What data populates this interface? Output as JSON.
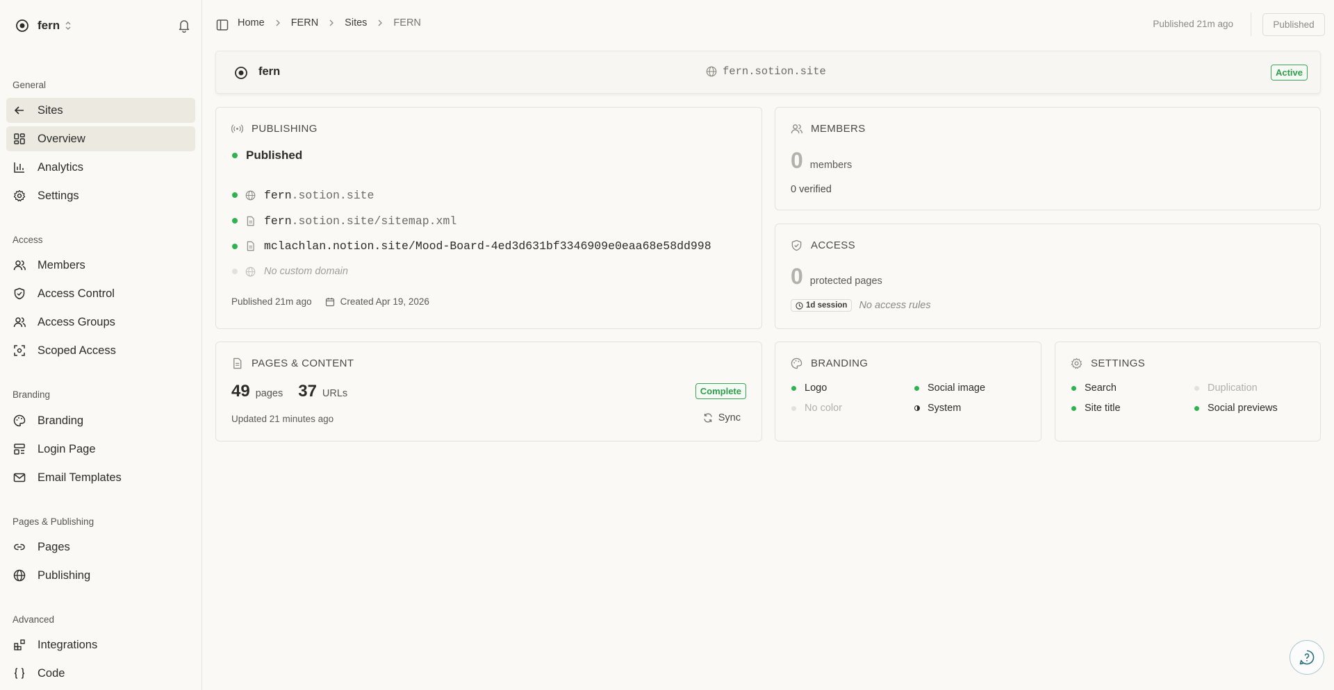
{
  "workspace": {
    "name": "fern",
    "logo_icon": "target-icon"
  },
  "sidebar": {
    "sections": [
      {
        "title": "General",
        "items": [
          {
            "label": "Sites",
            "icon": "arrow-left-icon",
            "active": true
          },
          {
            "label": "Overview",
            "icon": "grid-icon",
            "active": true
          },
          {
            "label": "Analytics",
            "icon": "bar-chart-icon"
          },
          {
            "label": "Settings",
            "icon": "gear-icon"
          }
        ]
      },
      {
        "title": "Access",
        "items": [
          {
            "label": "Members",
            "icon": "users-icon"
          },
          {
            "label": "Access Control",
            "icon": "shield-icon"
          },
          {
            "label": "Access Groups",
            "icon": "users-icon"
          },
          {
            "label": "Scoped Access",
            "icon": "scope-icon"
          }
        ]
      },
      {
        "title": "Branding",
        "items": [
          {
            "label": "Branding",
            "icon": "palette-icon"
          },
          {
            "label": "Login Page",
            "icon": "layout-icon"
          },
          {
            "label": "Email Templates",
            "icon": "mail-icon"
          }
        ]
      },
      {
        "title": "Pages & Publishing",
        "items": [
          {
            "label": "Pages",
            "icon": "link-icon"
          },
          {
            "label": "Publishing",
            "icon": "globe-icon"
          }
        ]
      },
      {
        "title": "Advanced",
        "items": [
          {
            "label": "Integrations",
            "icon": "blocks-icon"
          },
          {
            "label": "Code",
            "icon": "braces-icon"
          }
        ]
      }
    ]
  },
  "topbar": {
    "breadcrumbs": [
      "Home",
      "FERN",
      "Sites",
      "FERN"
    ],
    "published_ago": "Published 21m ago",
    "publish_button": "Published"
  },
  "site": {
    "name": "fern",
    "domain": "fern.sotion.site",
    "status": "Active"
  },
  "publishing": {
    "title": "PUBLISHING",
    "status": "Published",
    "links": [
      {
        "strong": "fern",
        "rest": ".sotion.site",
        "icon": "globe-icon",
        "active": true
      },
      {
        "strong": "fern",
        "rest": ".sotion.site/sitemap.xml",
        "icon": "file-icon",
        "active": true
      },
      {
        "strong": "mclachlan.notion.site/Mood-Board-4ed3d631bf3346909e0eaa68e58dd998",
        "rest": "",
        "icon": "file-icon",
        "active": true
      }
    ],
    "no_custom_domain": "No custom domain",
    "published_ago": "Published 21m ago",
    "created": "Created Apr 19, 2026"
  },
  "members": {
    "title": "MEMBERS",
    "count": "0",
    "count_label": "members",
    "verified": "0 verified"
  },
  "access": {
    "title": "ACCESS",
    "count": "0",
    "count_label": "protected pages",
    "session": "1d session",
    "no_rules": "No access rules"
  },
  "pages_content": {
    "title": "PAGES & CONTENT",
    "pages": "49",
    "pages_label": "pages",
    "urls": "37",
    "urls_label": "URLs",
    "status": "Complete",
    "updated": "Updated 21 minutes ago",
    "sync_label": "Sync"
  },
  "branding": {
    "title": "BRANDING",
    "items": [
      "Logo",
      "Social image",
      "No color",
      "System"
    ]
  },
  "settings_card": {
    "title": "SETTINGS",
    "items": [
      "Search",
      "Duplication",
      "Site title",
      "Social previews"
    ]
  },
  "colors": {
    "accent_green": "#2fb34f",
    "background": "#faf9f6",
    "active_nav": "#ece9e1"
  }
}
